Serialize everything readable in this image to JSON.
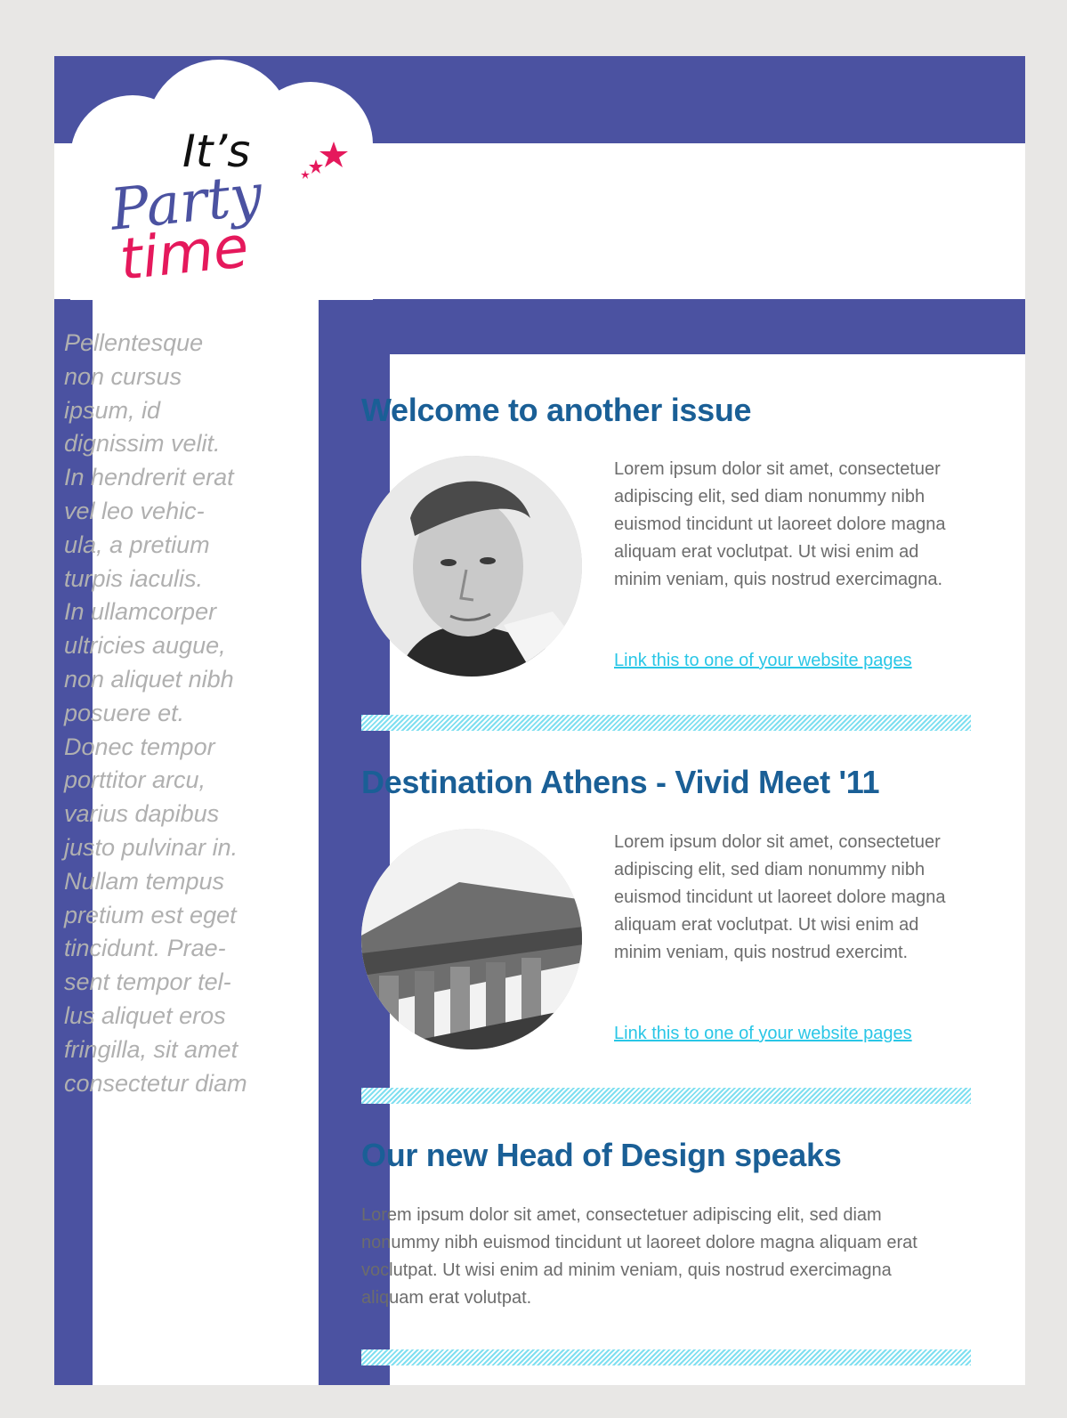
{
  "logo": {
    "line1": "It’s",
    "line2": "Party",
    "line3": "time",
    "icon": "star-icon"
  },
  "sidebar": {
    "text": "Pellentesque\nnon cursus\nipsum, id\ndignissim velit.\nIn hendrerit erat\nvel leo vehic-\nula, a pretium\nturpis iaculis.\nIn ullamcorper\nultricies augue,\nnon aliquet nibh\nposuere et.\nDonec tempor\nporttitor arcu,\nvarius dapibus\njusto pulvinar in.\nNullam tempus\npretium est eget\ntincidunt. Prae-\nsent tempor tel-\nlus aliquet eros\nfringilla, sit amet\nconsectetur diam"
  },
  "articles": [
    {
      "title": "Welcome to another issue",
      "body": "Lorem ipsum dolor sit amet, consectetuer adipiscing elit, sed diam nonummy nibh euismod tincidunt ut laoreet dolore magna aliquam erat voclutpat. Ut wisi enim ad minim veniam, quis nostrud exercimagna.",
      "link": "Link this to one of your website pages",
      "image": "portrait-photo"
    },
    {
      "title": "Destination Athens - Vivid Meet '11",
      "body": "Lorem ipsum dolor sit amet, consectetuer adipiscing elit, sed diam nonummy nibh euismod tincidunt ut laoreet dolore magna aliquam erat voclutpat. Ut wisi enim ad minim veniam, quis nostrud exercimt.",
      "link": "Link this to one of your website pages",
      "image": "temple-photo"
    },
    {
      "title": "Our new Head of Design speaks",
      "body": "Lorem ipsum dolor sit amet, consectetuer adipiscing elit, sed diam nonummy nibh euismod tincidunt ut laoreet dolore magna aliquam erat voclutpat. Ut wisi enim ad minim veniam, quis nostrud exercimagna aliquam erat volutpat."
    }
  ],
  "colors": {
    "frame": "#4b52a1",
    "title": "#1a5f96",
    "link": "#29c6e6",
    "divider": "#7fdff0",
    "logo_blue": "#4b52a1",
    "logo_pink": "#e5195c",
    "sidebar_text": "#b0b0b0"
  }
}
